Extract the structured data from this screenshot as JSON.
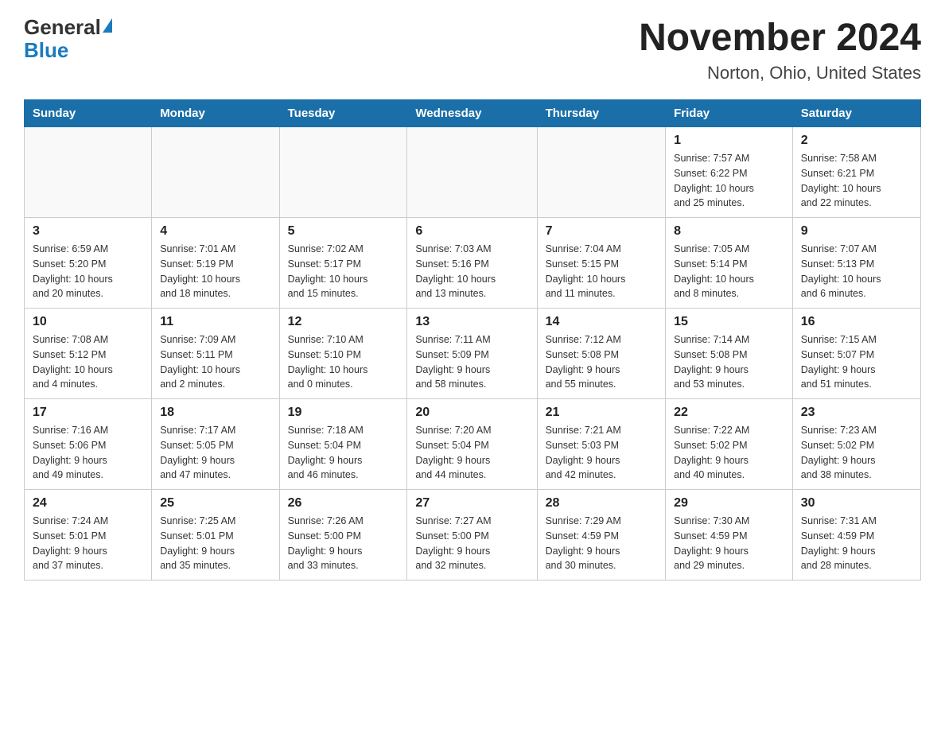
{
  "header": {
    "logo_general": "General",
    "logo_blue": "Blue",
    "month_year": "November 2024",
    "location": "Norton, Ohio, United States"
  },
  "days_of_week": [
    "Sunday",
    "Monday",
    "Tuesday",
    "Wednesday",
    "Thursday",
    "Friday",
    "Saturday"
  ],
  "weeks": [
    [
      {
        "day": "",
        "info": ""
      },
      {
        "day": "",
        "info": ""
      },
      {
        "day": "",
        "info": ""
      },
      {
        "day": "",
        "info": ""
      },
      {
        "day": "",
        "info": ""
      },
      {
        "day": "1",
        "info": "Sunrise: 7:57 AM\nSunset: 6:22 PM\nDaylight: 10 hours\nand 25 minutes."
      },
      {
        "day": "2",
        "info": "Sunrise: 7:58 AM\nSunset: 6:21 PM\nDaylight: 10 hours\nand 22 minutes."
      }
    ],
    [
      {
        "day": "3",
        "info": "Sunrise: 6:59 AM\nSunset: 5:20 PM\nDaylight: 10 hours\nand 20 minutes."
      },
      {
        "day": "4",
        "info": "Sunrise: 7:01 AM\nSunset: 5:19 PM\nDaylight: 10 hours\nand 18 minutes."
      },
      {
        "day": "5",
        "info": "Sunrise: 7:02 AM\nSunset: 5:17 PM\nDaylight: 10 hours\nand 15 minutes."
      },
      {
        "day": "6",
        "info": "Sunrise: 7:03 AM\nSunset: 5:16 PM\nDaylight: 10 hours\nand 13 minutes."
      },
      {
        "day": "7",
        "info": "Sunrise: 7:04 AM\nSunset: 5:15 PM\nDaylight: 10 hours\nand 11 minutes."
      },
      {
        "day": "8",
        "info": "Sunrise: 7:05 AM\nSunset: 5:14 PM\nDaylight: 10 hours\nand 8 minutes."
      },
      {
        "day": "9",
        "info": "Sunrise: 7:07 AM\nSunset: 5:13 PM\nDaylight: 10 hours\nand 6 minutes."
      }
    ],
    [
      {
        "day": "10",
        "info": "Sunrise: 7:08 AM\nSunset: 5:12 PM\nDaylight: 10 hours\nand 4 minutes."
      },
      {
        "day": "11",
        "info": "Sunrise: 7:09 AM\nSunset: 5:11 PM\nDaylight: 10 hours\nand 2 minutes."
      },
      {
        "day": "12",
        "info": "Sunrise: 7:10 AM\nSunset: 5:10 PM\nDaylight: 10 hours\nand 0 minutes."
      },
      {
        "day": "13",
        "info": "Sunrise: 7:11 AM\nSunset: 5:09 PM\nDaylight: 9 hours\nand 58 minutes."
      },
      {
        "day": "14",
        "info": "Sunrise: 7:12 AM\nSunset: 5:08 PM\nDaylight: 9 hours\nand 55 minutes."
      },
      {
        "day": "15",
        "info": "Sunrise: 7:14 AM\nSunset: 5:08 PM\nDaylight: 9 hours\nand 53 minutes."
      },
      {
        "day": "16",
        "info": "Sunrise: 7:15 AM\nSunset: 5:07 PM\nDaylight: 9 hours\nand 51 minutes."
      }
    ],
    [
      {
        "day": "17",
        "info": "Sunrise: 7:16 AM\nSunset: 5:06 PM\nDaylight: 9 hours\nand 49 minutes."
      },
      {
        "day": "18",
        "info": "Sunrise: 7:17 AM\nSunset: 5:05 PM\nDaylight: 9 hours\nand 47 minutes."
      },
      {
        "day": "19",
        "info": "Sunrise: 7:18 AM\nSunset: 5:04 PM\nDaylight: 9 hours\nand 46 minutes."
      },
      {
        "day": "20",
        "info": "Sunrise: 7:20 AM\nSunset: 5:04 PM\nDaylight: 9 hours\nand 44 minutes."
      },
      {
        "day": "21",
        "info": "Sunrise: 7:21 AM\nSunset: 5:03 PM\nDaylight: 9 hours\nand 42 minutes."
      },
      {
        "day": "22",
        "info": "Sunrise: 7:22 AM\nSunset: 5:02 PM\nDaylight: 9 hours\nand 40 minutes."
      },
      {
        "day": "23",
        "info": "Sunrise: 7:23 AM\nSunset: 5:02 PM\nDaylight: 9 hours\nand 38 minutes."
      }
    ],
    [
      {
        "day": "24",
        "info": "Sunrise: 7:24 AM\nSunset: 5:01 PM\nDaylight: 9 hours\nand 37 minutes."
      },
      {
        "day": "25",
        "info": "Sunrise: 7:25 AM\nSunset: 5:01 PM\nDaylight: 9 hours\nand 35 minutes."
      },
      {
        "day": "26",
        "info": "Sunrise: 7:26 AM\nSunset: 5:00 PM\nDaylight: 9 hours\nand 33 minutes."
      },
      {
        "day": "27",
        "info": "Sunrise: 7:27 AM\nSunset: 5:00 PM\nDaylight: 9 hours\nand 32 minutes."
      },
      {
        "day": "28",
        "info": "Sunrise: 7:29 AM\nSunset: 4:59 PM\nDaylight: 9 hours\nand 30 minutes."
      },
      {
        "day": "29",
        "info": "Sunrise: 7:30 AM\nSunset: 4:59 PM\nDaylight: 9 hours\nand 29 minutes."
      },
      {
        "day": "30",
        "info": "Sunrise: 7:31 AM\nSunset: 4:59 PM\nDaylight: 9 hours\nand 28 minutes."
      }
    ]
  ]
}
